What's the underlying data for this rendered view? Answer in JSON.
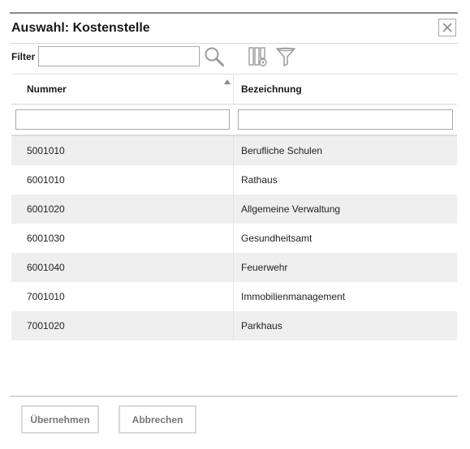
{
  "dialog": {
    "title": "Auswahl: Kostenstelle",
    "close_icon": "close-icon"
  },
  "filter": {
    "label": "Filter",
    "value": "",
    "placeholder": "",
    "icons": [
      "search-icon",
      "columns-settings-icon",
      "filter-icon"
    ]
  },
  "table": {
    "columns": [
      {
        "key": "nummer",
        "label": "Nummer",
        "sorted": "ascending"
      },
      {
        "key": "bezeichnung",
        "label": "Bezeichnung"
      }
    ],
    "column_filters": [
      "",
      ""
    ],
    "rows": [
      {
        "nummer": "5001010",
        "bezeichnung": "Berufliche Schulen"
      },
      {
        "nummer": "6001010",
        "bezeichnung": "Rathaus"
      },
      {
        "nummer": "6001020",
        "bezeichnung": "Allgemeine Verwaltung"
      },
      {
        "nummer": "6001030",
        "bezeichnung": "Gesundheitsamt"
      },
      {
        "nummer": "6001040",
        "bezeichnung": "Feuerwehr"
      },
      {
        "nummer": "7001010",
        "bezeichnung": "Immobilienmanagement"
      },
      {
        "nummer": "7001020",
        "bezeichnung": "Parkhaus"
      }
    ]
  },
  "footer": {
    "accept_label": "Übernehmen",
    "cancel_label": "Abbrechen"
  },
  "colors": {
    "row_stripe": "#efefef",
    "border": "#a9a9a9",
    "button_text": "#777777"
  }
}
